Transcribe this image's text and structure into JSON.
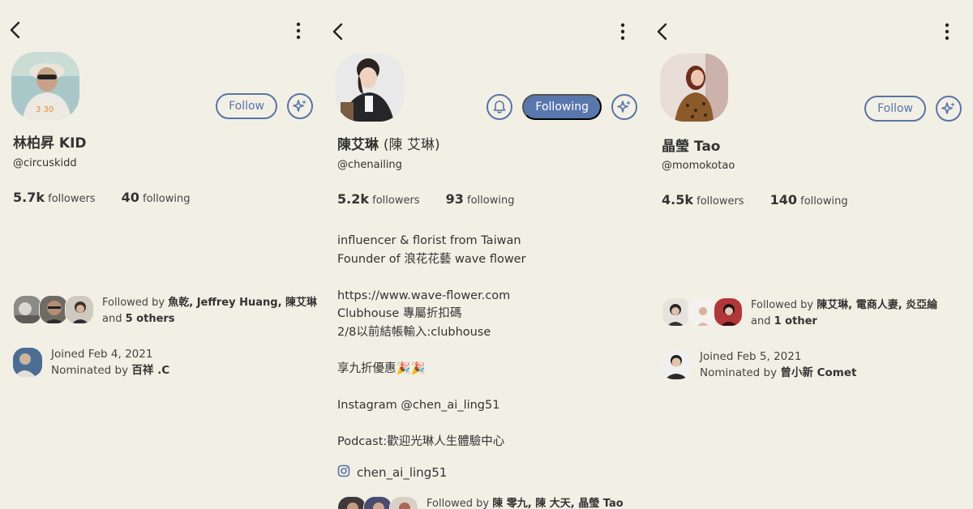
{
  "profiles": [
    {
      "name": "林柏昇 KID",
      "name_extra": "",
      "handle": "@circuskidd",
      "followers_count": "5.7k",
      "followers_label": "followers",
      "following_count": "40",
      "following_label": "following",
      "follow_label": "Follow",
      "followed_by_prefix": "Followed by",
      "followed_by_names": "魚乾, Jeffrey Huang, 陳艾琳",
      "and_label": "and",
      "others": "5 others",
      "joined": "Joined Feb 4, 2021",
      "nominated_prefix": "Nominated by",
      "nominated_by": "百祥 .C"
    },
    {
      "name": "陳艾琳",
      "name_extra": "(陳 艾琳)",
      "handle": "@chenailing",
      "followers_count": "5.2k",
      "followers_label": "followers",
      "following_count": "93",
      "following_label": "following",
      "follow_label": "Following",
      "bio": [
        "influencer & florist from Taiwan",
        "Founder of 浪花花藝 wave flower",
        "",
        "https://www.wave-flower.com",
        "Clubhouse 專屬折扣碼",
        "2/8以前結帳輸入:clubhouse",
        "",
        "享九折優惠🎉🎉",
        "",
        "Instagram @chen_ai_ling51",
        "",
        "Podcast:歡迎光琳人生體驗中心"
      ],
      "instagram": "chen_ai_ling51",
      "followed_by_prefix": "Followed by",
      "followed_by_names": "陳 零九, 陳 大天, 晶瑩 Tao"
    },
    {
      "name": "晶瑩 Tao",
      "name_extra": "",
      "handle": "@momokotao",
      "followers_count": "4.5k",
      "followers_label": "followers",
      "following_count": "140",
      "following_label": "following",
      "follow_label": "Follow",
      "followed_by_prefix": "Followed by",
      "followed_by_names": "陳艾琳, 電商人妻, 炎亞綸",
      "and_label": "and",
      "others": "1 other",
      "joined": "Joined Feb 5, 2021",
      "nominated_prefix": "Nominated by",
      "nominated_by": "曾小新 Comet"
    }
  ],
  "icons": [
    "back-arrow-icon",
    "more-vertical-icon",
    "bell-icon",
    "sparkle-icon",
    "instagram-icon"
  ],
  "colors": {
    "background": "#f2efe5",
    "accent": "#5874a6",
    "following_bg": "#5a77ad"
  }
}
